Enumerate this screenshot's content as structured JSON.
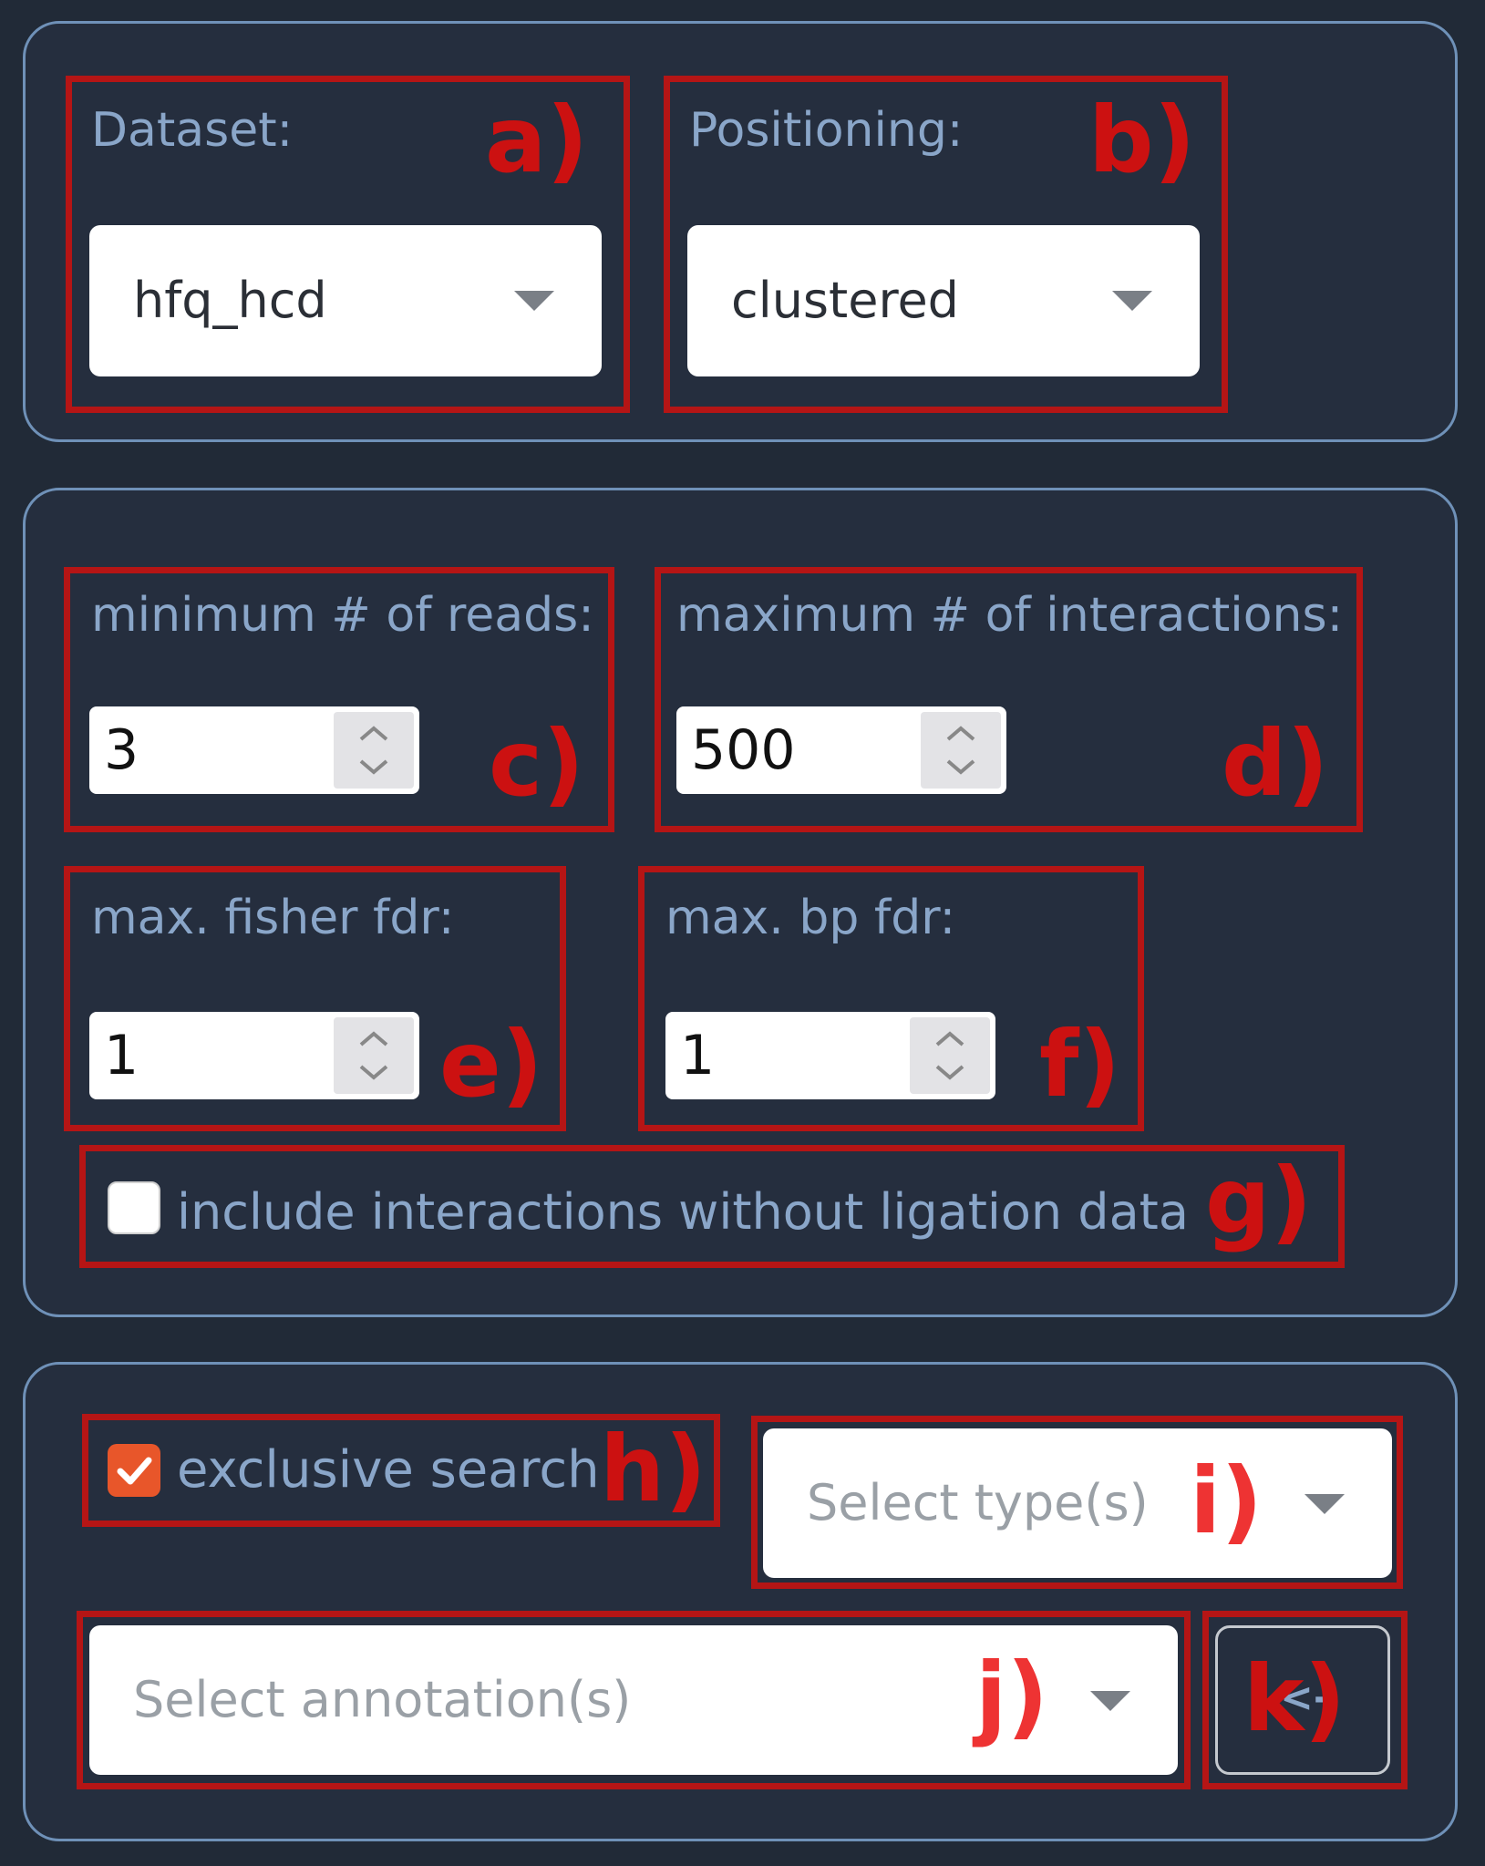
{
  "panel1": {
    "dataset": {
      "label": "Dataset:",
      "value": "hfq_hcd",
      "marker": "a)"
    },
    "positioning": {
      "label": "Positioning:",
      "value": "clustered",
      "marker": "b)"
    }
  },
  "panel2": {
    "min_reads": {
      "label": "minimum # of reads:",
      "value": "3",
      "marker": "c)"
    },
    "max_interactions": {
      "label": "maximum # of interactions:",
      "value": "500",
      "marker": "d)"
    },
    "fisher_fdr": {
      "label": "max. fisher fdr:",
      "value": "1",
      "marker": "e)"
    },
    "bp_fdr": {
      "label": "max. bp fdr:",
      "value": "1",
      "marker": "f)"
    },
    "no_ligation": {
      "label": "include interactions without ligation data",
      "checked": false,
      "marker": "g)"
    }
  },
  "panel3": {
    "exclusive": {
      "label": "exclusive search",
      "checked": true,
      "marker": "h)"
    },
    "type_select": {
      "placeholder": "Select type(s)",
      "marker": "i)"
    },
    "annotation_select": {
      "placeholder": "Select annotation(s)",
      "marker": "j)"
    },
    "back_button": {
      "label": "<-",
      "marker": "k)"
    }
  },
  "colors": {
    "background": "#212a37",
    "panel_border": "#6f91b8",
    "annotation": "#b51515",
    "label_text": "#8aa6c9",
    "checkbox_checked": "#e8562a"
  },
  "icons": [
    "chevron-down-icon",
    "spinner-arrows-icon",
    "checkmark-icon"
  ]
}
